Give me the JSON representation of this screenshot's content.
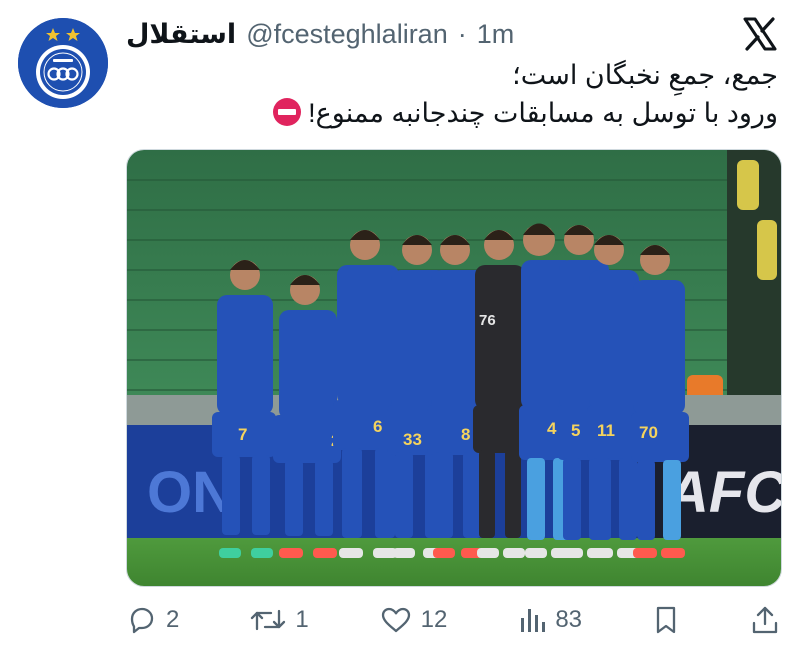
{
  "tweet": {
    "display_name": "استقلال",
    "handle": "@fcesteghlaliran",
    "separator": "·",
    "time": "1m",
    "text_line1": "جمع، جمعِ نخبگان است؛",
    "text_line2": "ورود با توسل به مسابقات چندجانبه ممنوع!",
    "emoji": "no-entry-icon"
  },
  "media": {
    "jersey_numbers": [
      "7",
      "2",
      "6",
      "33",
      "8",
      "76",
      "4",
      "5",
      "11",
      "70"
    ],
    "board_text_left": "ON",
    "board_text_right": "AFC"
  },
  "actions": {
    "replies": "2",
    "reposts": "1",
    "likes": "12",
    "views": "83"
  },
  "colors": {
    "brand_blue": "#1e4fb0",
    "text_primary": "#0f1419",
    "text_secondary": "#536471",
    "no_entry_red": "#e0245e"
  }
}
